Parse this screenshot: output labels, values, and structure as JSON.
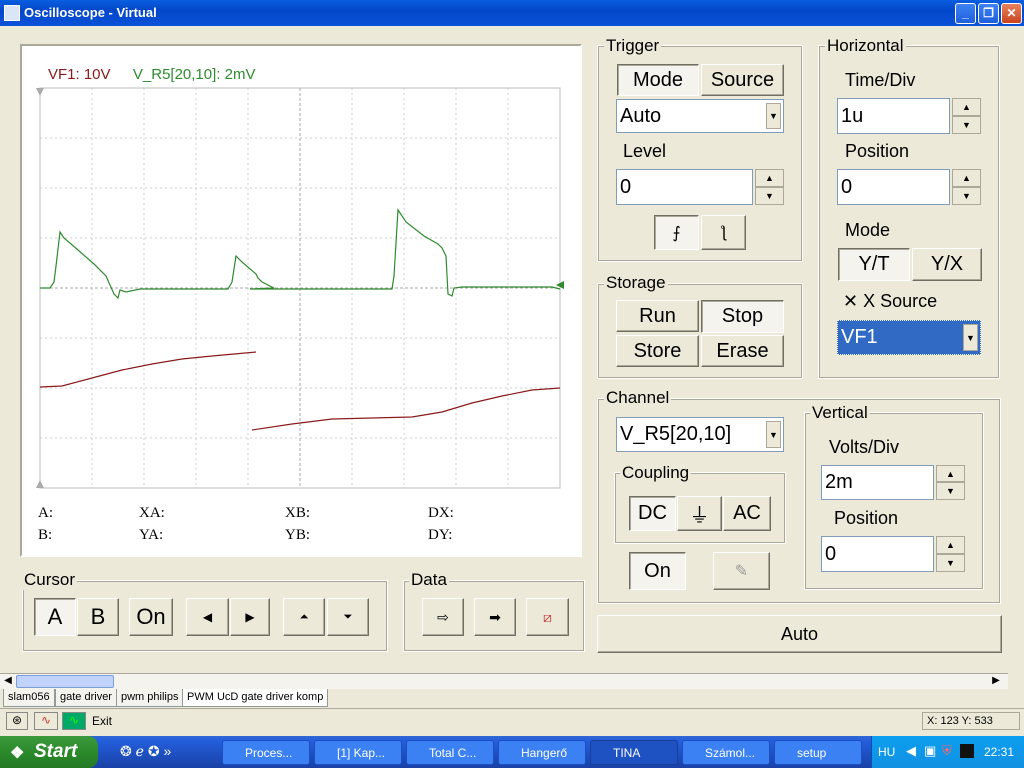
{
  "window": {
    "title": "Oscilloscope - Virtual"
  },
  "display": {
    "legend": [
      {
        "label": "VF1: 10V",
        "color": "#8b1a1a"
      },
      {
        "label": "V_R5[20,10]: 2mV",
        "color": "#2e8b2e"
      }
    ],
    "measurements": {
      "a": "A:",
      "b": "B:",
      "xa": "XA:",
      "ya": "YA:",
      "xb": "XB:",
      "yb": "YB:",
      "dx": "DX:",
      "dy": "DY:"
    }
  },
  "trigger": {
    "title": "Trigger",
    "mode_label": "Mode",
    "source_label": "Source",
    "mode_value": "Auto",
    "level_label": "Level",
    "level_value": "0"
  },
  "horizontal": {
    "title": "Horizontal",
    "timediv_label": "Time/Div",
    "timediv_value": "1u",
    "position_label": "Position",
    "position_value": "0",
    "mode_label": "Mode",
    "yt_label": "Y/T",
    "yx_label": "Y/X",
    "xsource_label": "X Source",
    "xsource_value": "VF1"
  },
  "storage": {
    "title": "Storage",
    "run_label": "Run",
    "stop_label": "Stop",
    "store_label": "Store",
    "erase_label": "Erase"
  },
  "channel": {
    "title": "Channel",
    "value": "V_R5[20,10]",
    "coupling_title": "Coupling",
    "dc_label": "DC",
    "gnd_label": "⏚",
    "ac_label": "AC",
    "on_label": "On"
  },
  "vertical": {
    "title": "Vertical",
    "voltsdiv_label": "Volts/Div",
    "voltsdiv_value": "2m",
    "position_label": "Position",
    "position_value": "0"
  },
  "cursor": {
    "title": "Cursor",
    "a_label": "A",
    "b_label": "B",
    "on_label": "On"
  },
  "data_group": {
    "title": "Data"
  },
  "auto_button": "Auto",
  "tabs": [
    "slam056",
    "gate driver",
    "pwm philips",
    "PWM UcD gate driver komp"
  ],
  "status": {
    "exit_label": "Exit",
    "coords": "X: 123  Y: 533"
  },
  "taskbar": {
    "start_label": "Start",
    "tasks": [
      "Proces...",
      "[1] Kap...",
      "Total C...",
      "Hangerő",
      "TINA",
      "Számol...",
      "setup"
    ],
    "lang": "HU",
    "clock": "22:31"
  },
  "colors": {
    "trace_vf1": "#8b1a1a",
    "trace_vr5": "#2e8b2e",
    "selection": "#316ac5"
  }
}
